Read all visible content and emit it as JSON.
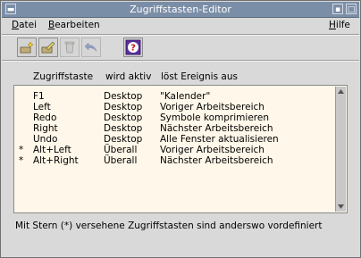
{
  "window": {
    "title": "Zugriffstasten-Editor"
  },
  "menus": [
    {
      "label": "Datei",
      "mnemonic_index": 0
    },
    {
      "label": "Bearbeiten",
      "mnemonic_index": 0
    },
    {
      "label": "Hilfe",
      "mnemonic_index": 0
    }
  ],
  "toolbar": [
    {
      "icon": "new-shortcut-icon"
    },
    {
      "icon": "edit-shortcut-icon"
    },
    {
      "icon": "delete-shortcut-icon"
    },
    {
      "icon": "undo-arrow-icon"
    },
    {
      "icon": "help-icon"
    }
  ],
  "columns": {
    "key": "Zugriffstaste",
    "scope": "wird aktiv",
    "action": "löst Ereignis aus"
  },
  "rows": [
    {
      "star": "",
      "key": "F1",
      "scope": "Desktop",
      "action": "\"Kalender\""
    },
    {
      "star": "",
      "key": "Left",
      "scope": "Desktop",
      "action": "Voriger Arbeitsbereich"
    },
    {
      "star": "",
      "key": "Redo",
      "scope": "Desktop",
      "action": "Symbole komprimieren"
    },
    {
      "star": "",
      "key": "Right",
      "scope": "Desktop",
      "action": "Nächster Arbeitsbereich"
    },
    {
      "star": "",
      "key": "Undo",
      "scope": "Desktop",
      "action": "Alle Fenster aktualisieren"
    },
    {
      "star": "*",
      "key": "Alt+Left",
      "scope": "Überall",
      "action": "Voriger Arbeitsbereich"
    },
    {
      "star": "*",
      "key": "Alt+Right",
      "scope": "Überall",
      "action": "Nächster Arbeitsbereich"
    }
  ],
  "footer": "Mit Stern (*) versehene Zugriffstasten sind anderswo vordefiniert"
}
